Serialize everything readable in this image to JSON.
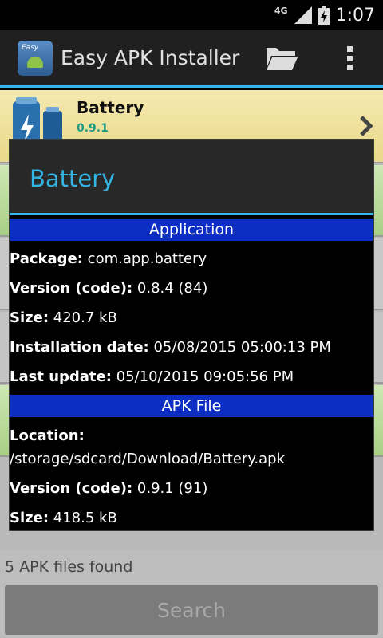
{
  "status_bar": {
    "network": "4G",
    "time": "1:07"
  },
  "action_bar": {
    "title": "Easy APK Installer",
    "icon_text": "Easy"
  },
  "list": {
    "items": [
      {
        "name": "Battery",
        "version": "0.9.1"
      }
    ],
    "files_found": "5 APK files found",
    "search_label": "Search"
  },
  "dialog": {
    "title": "Battery",
    "application_section": "Application",
    "package_label": "Package:",
    "package_value": "com.app.battery",
    "version_label": "Version (code):",
    "version_value": "0.8.4 (84)",
    "size_label": "Size:",
    "size_value": "420.7 kB",
    "install_label": "Installation date:",
    "install_value": "05/08/2015 05:00:13 PM",
    "update_label": "Last update:",
    "update_value": "05/10/2015 09:05:56 PM",
    "apk_section": "APK File",
    "location_label": "Location:",
    "location_value": "/storage/sdcard/Download/Battery.apk",
    "apk_version_label": "Version (code):",
    "apk_version_value": "0.9.1 (91)",
    "apk_size_label": "Size:",
    "apk_size_value": "418.5 kB"
  },
  "colors": {
    "accent": "#33b5e5",
    "section_bg": "#0c2ec2",
    "version_text": "#1e9c86"
  }
}
